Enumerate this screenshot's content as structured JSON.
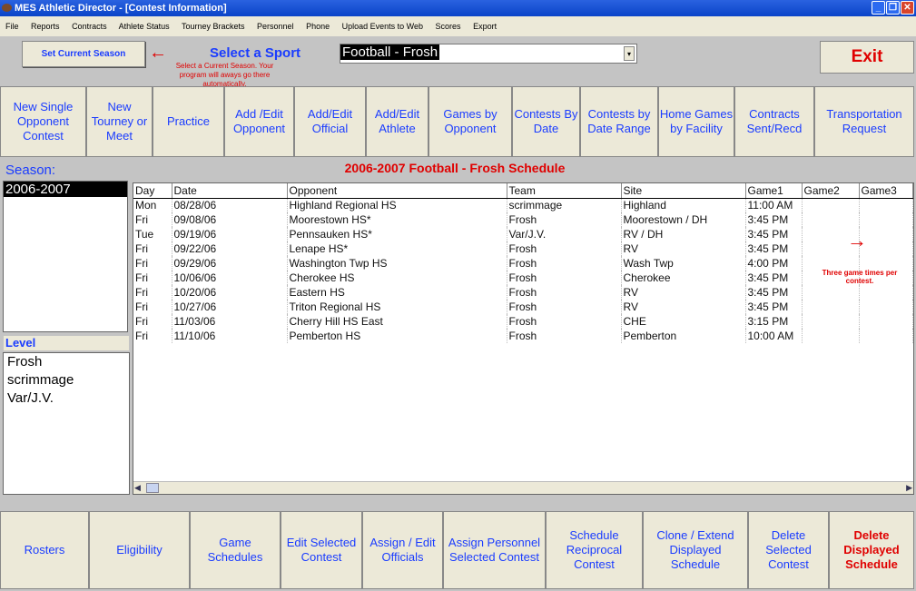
{
  "window": {
    "title": "MES Athletic Director - [Contest Information]",
    "controls": [
      "_",
      "❐",
      "✕"
    ]
  },
  "menu": [
    "File",
    "Reports",
    "Contracts",
    "Athlete Status",
    "Tourney Brackets",
    "Personnel",
    "Phone",
    "Upload Events to Web",
    "Scores",
    "Export"
  ],
  "header": {
    "set_season": "Set Current Season",
    "select_sport": "Select a Sport",
    "sport_value": "Football - Frosh",
    "exit": "Exit",
    "note": "Select a Current Season. Your program will aways go there automatically."
  },
  "toolbar": [
    "New Single Opponent Contest",
    "New Tourney or Meet",
    "Practice",
    "Add /Edit Opponent",
    "Add/Edit Official",
    "Add/Edit Athlete",
    "Games by Opponent",
    "Contests By Date",
    "Contests by Date Range",
    "Home Games by Facility",
    "Contracts Sent/Recd",
    "Transportation Request"
  ],
  "season": {
    "label": "Season:",
    "items": [
      "2006-2007"
    ],
    "selected": "2006-2007"
  },
  "level": {
    "label": "Level",
    "items": [
      "Frosh",
      "scrimmage",
      "Var/J.V."
    ]
  },
  "schedule": {
    "title": "2006-2007 Football - Frosh Schedule",
    "columns": [
      "Day",
      "Date",
      "Opponent",
      "Team",
      "Site",
      "Game1",
      "Game2",
      "Game3"
    ],
    "rows": [
      [
        "Mon",
        "08/28/06",
        "Highland Regional HS",
        "scrimmage",
        "Highland",
        "11:00 AM",
        "",
        ""
      ],
      [
        "Fri",
        "09/08/06",
        "Moorestown HS*",
        "Frosh",
        "Moorestown / DH",
        "3:45 PM",
        "",
        ""
      ],
      [
        "Tue",
        "09/19/06",
        "Pennsauken HS*",
        "Var/J.V.",
        "RV / DH",
        "3:45 PM",
        "",
        ""
      ],
      [
        "Fri",
        "09/22/06",
        "Lenape HS*",
        "Frosh",
        "RV",
        "3:45 PM",
        "",
        ""
      ],
      [
        "Fri",
        "09/29/06",
        "Washington Twp HS",
        "Frosh",
        "Wash Twp",
        "4:00 PM",
        "",
        ""
      ],
      [
        "Fri",
        "10/06/06",
        "Cherokee HS",
        "Frosh",
        "Cherokee",
        "3:45 PM",
        "",
        ""
      ],
      [
        "Fri",
        "10/20/06",
        "Eastern HS",
        "Frosh",
        "RV",
        "3:45 PM",
        "",
        ""
      ],
      [
        "Fri",
        "10/27/06",
        "Triton Regional HS",
        "Frosh",
        "RV",
        "3:45 PM",
        "",
        ""
      ],
      [
        "Fri",
        "11/03/06",
        "Cherry Hill HS East",
        "Frosh",
        "CHE",
        "3:15 PM",
        "",
        ""
      ],
      [
        "Fri",
        "11/10/06",
        "Pemberton HS",
        "Frosh",
        "Pemberton",
        "10:00 AM",
        "",
        ""
      ]
    ],
    "annotation": "Three game times per contest."
  },
  "bottom": [
    "Rosters",
    "Eligibility",
    "Game Schedules",
    "Edit Selected Contest",
    "Assign / Edit Officials",
    "Assign Personnel Selected Contest",
    "Schedule Reciprocal Contest",
    "Clone / Extend Displayed Schedule",
    "Delete Selected Contest",
    "Delete Displayed Schedule"
  ],
  "colors": {
    "accent": "#1a3cff",
    "warning": "#e00000",
    "title_bar": "#0a44c8"
  }
}
